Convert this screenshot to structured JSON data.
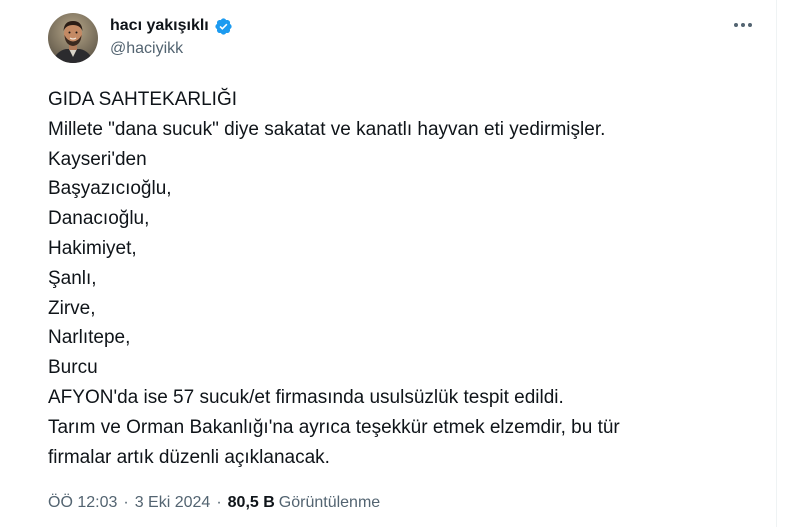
{
  "author": {
    "display_name": "hacı yakışıklı",
    "handle": "@haciyikk",
    "verified": true
  },
  "post": {
    "lines": [
      "GIDA SAHTEKARLIĞI",
      "Millete \"dana sucuk\" diye sakatat ve kanatlı hayvan eti yedirmişler.",
      "Kayseri'den",
      "Başyazıcıoğlu,",
      "Danacıoğlu,",
      "Hakimiyet,",
      "Şanlı,",
      "Zirve,",
      "Narlıtepe,",
      "Burcu",
      "AFYON'da ise 57 sucuk/et firmasında usulsüzlük tespit edildi.",
      "Tarım ve Orman Bakanlığı'na ayrıca teşekkür etmek elzemdir, bu tür",
      "firmalar artık düzenli açıklanacak."
    ]
  },
  "meta": {
    "time": "ÖÖ 12:03",
    "date": "3 Eki 2024",
    "separator": "·",
    "views_count": "80,5 B",
    "views_label": "Görüntülenme"
  },
  "icons": {
    "verified": "verified-badge-icon",
    "more": "more-options-icon"
  },
  "colors": {
    "verified_blue": "#1d9bf0",
    "text_primary": "#0f1419",
    "text_secondary": "#536471"
  }
}
